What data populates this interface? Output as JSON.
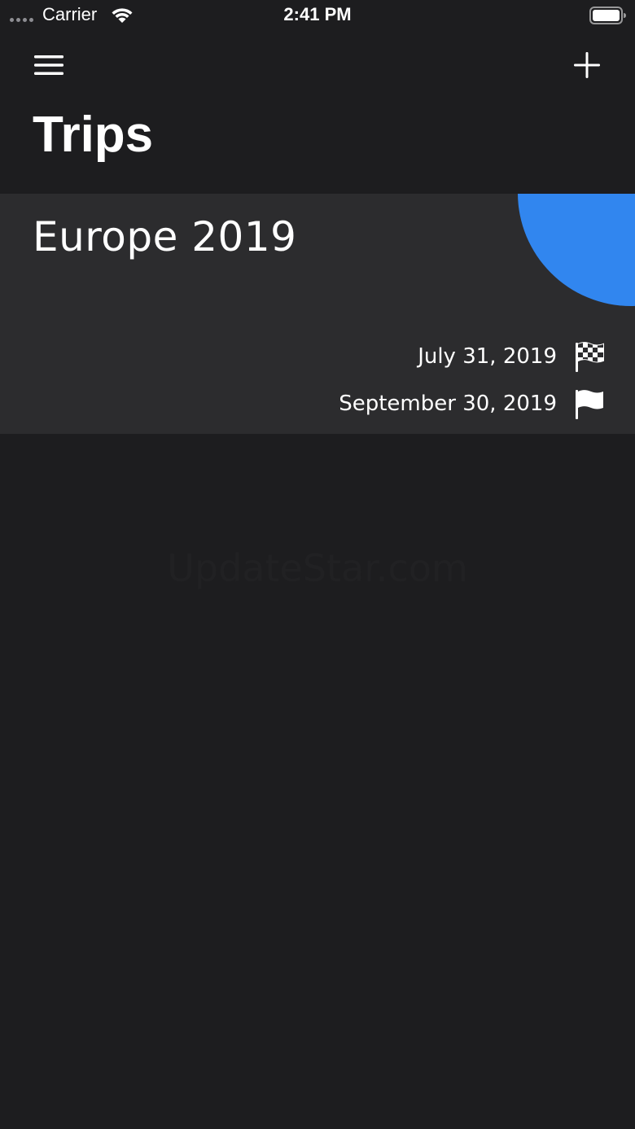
{
  "status_bar": {
    "carrier": "Carrier",
    "time": "2:41 PM"
  },
  "nav": {
    "title": "Trips",
    "menu_icon": "hamburger-menu-icon",
    "add_icon": "plus-icon"
  },
  "trips": [
    {
      "name": "Europe 2019",
      "start_date": "July 31, 2019",
      "start_icon": "checkered-flag-icon",
      "end_date": "September 30, 2019",
      "end_icon": "flag-icon",
      "accent_color": "#3186ef"
    }
  ],
  "watermark": "UpdateStar.com",
  "colors": {
    "background": "#1d1d1f",
    "card": "#2c2c2e",
    "text": "#ffffff"
  }
}
